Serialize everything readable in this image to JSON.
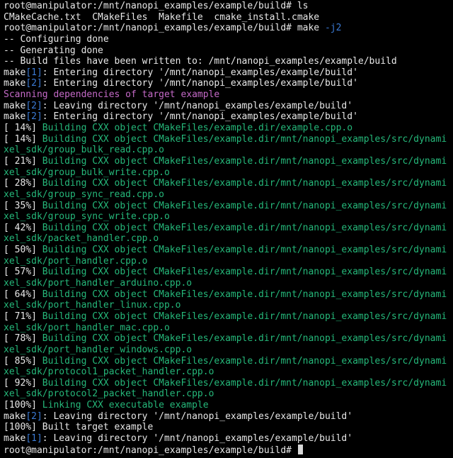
{
  "colors": {
    "background": "#000000",
    "default": "#e8e8e8",
    "green": "#25b87a",
    "blue": "#3b7bd6",
    "magenta": "#c56ac8",
    "cursor": "#d8d8d8"
  },
  "terminal": {
    "lines": [
      [
        {
          "t": "root@manipulator:/mnt/nanopi_examples/example/build# ls",
          "c": "default"
        }
      ],
      [
        {
          "t": "CMakeCache.txt  CMakeFiles  Makefile  cmake_install.cmake",
          "c": "default"
        }
      ],
      [
        {
          "t": "root@manipulator:/mnt/nanopi_examples/example/build# make ",
          "c": "default"
        },
        {
          "t": "-j2",
          "c": "blue"
        }
      ],
      [
        {
          "t": "-- Configuring done",
          "c": "default"
        }
      ],
      [
        {
          "t": "-- Generating done",
          "c": "default"
        }
      ],
      [
        {
          "t": "-- Build files have been written to: /mnt/nanopi_examples/example/build",
          "c": "default"
        }
      ],
      [
        {
          "t": "make",
          "c": "default"
        },
        {
          "t": "[1]",
          "c": "blue"
        },
        {
          "t": ": Entering directory '/mnt/nanopi_examples/example/build'",
          "c": "default"
        }
      ],
      [
        {
          "t": "make",
          "c": "default"
        },
        {
          "t": "[2]",
          "c": "blue"
        },
        {
          "t": ": Entering directory '/mnt/nanopi_examples/example/build'",
          "c": "default"
        }
      ],
      [
        {
          "t": "Scanning dependencies of target example",
          "c": "magenta"
        }
      ],
      [
        {
          "t": "make",
          "c": "default"
        },
        {
          "t": "[2]",
          "c": "blue"
        },
        {
          "t": ": Leaving directory '/mnt/nanopi_examples/example/build'",
          "c": "default"
        }
      ],
      [
        {
          "t": "make",
          "c": "default"
        },
        {
          "t": "[2]",
          "c": "blue"
        },
        {
          "t": ": Entering directory '/mnt/nanopi_examples/example/build'",
          "c": "default"
        }
      ],
      [
        {
          "t": "[ 14%] ",
          "c": "default"
        },
        {
          "t": "Building CXX object CMakeFiles/example.dir/example.cpp.o",
          "c": "green"
        }
      ],
      [
        {
          "t": "[ 14%] ",
          "c": "default"
        },
        {
          "t": "Building CXX object CMakeFiles/example.dir/mnt/nanopi_examples/src/dynami",
          "c": "green"
        }
      ],
      [
        {
          "t": "xel_sdk/group_bulk_read.cpp.o",
          "c": "green"
        }
      ],
      [
        {
          "t": "[ 21%] ",
          "c": "default"
        },
        {
          "t": "Building CXX object CMakeFiles/example.dir/mnt/nanopi_examples/src/dynami",
          "c": "green"
        }
      ],
      [
        {
          "t": "xel_sdk/group_bulk_write.cpp.o",
          "c": "green"
        }
      ],
      [
        {
          "t": "[ 28%] ",
          "c": "default"
        },
        {
          "t": "Building CXX object CMakeFiles/example.dir/mnt/nanopi_examples/src/dynami",
          "c": "green"
        }
      ],
      [
        {
          "t": "xel_sdk/group_sync_read.cpp.o",
          "c": "green"
        }
      ],
      [
        {
          "t": "[ 35%] ",
          "c": "default"
        },
        {
          "t": "Building CXX object CMakeFiles/example.dir/mnt/nanopi_examples/src/dynami",
          "c": "green"
        }
      ],
      [
        {
          "t": "xel_sdk/group_sync_write.cpp.o",
          "c": "green"
        }
      ],
      [
        {
          "t": "[ 42%] ",
          "c": "default"
        },
        {
          "t": "Building CXX object CMakeFiles/example.dir/mnt/nanopi_examples/src/dynami",
          "c": "green"
        }
      ],
      [
        {
          "t": "xel_sdk/packet_handler.cpp.o",
          "c": "green"
        }
      ],
      [
        {
          "t": "[ 50%] ",
          "c": "default"
        },
        {
          "t": "Building CXX object CMakeFiles/example.dir/mnt/nanopi_examples/src/dynami",
          "c": "green"
        }
      ],
      [
        {
          "t": "xel_sdk/port_handler.cpp.o",
          "c": "green"
        }
      ],
      [
        {
          "t": "[ 57%] ",
          "c": "default"
        },
        {
          "t": "Building CXX object CMakeFiles/example.dir/mnt/nanopi_examples/src/dynami",
          "c": "green"
        }
      ],
      [
        {
          "t": "xel_sdk/port_handler_arduino.cpp.o",
          "c": "green"
        }
      ],
      [
        {
          "t": "[ 64%] ",
          "c": "default"
        },
        {
          "t": "Building CXX object CMakeFiles/example.dir/mnt/nanopi_examples/src/dynami",
          "c": "green"
        }
      ],
      [
        {
          "t": "xel_sdk/port_handler_linux.cpp.o",
          "c": "green"
        }
      ],
      [
        {
          "t": "[ 71%] ",
          "c": "default"
        },
        {
          "t": "Building CXX object CMakeFiles/example.dir/mnt/nanopi_examples/src/dynami",
          "c": "green"
        }
      ],
      [
        {
          "t": "xel_sdk/port_handler_mac.cpp.o",
          "c": "green"
        }
      ],
      [
        {
          "t": "[ 78%] ",
          "c": "default"
        },
        {
          "t": "Building CXX object CMakeFiles/example.dir/mnt/nanopi_examples/src/dynami",
          "c": "green"
        }
      ],
      [
        {
          "t": "xel_sdk/port_handler_windows.cpp.o",
          "c": "green"
        }
      ],
      [
        {
          "t": "[ 85%] ",
          "c": "default"
        },
        {
          "t": "Building CXX object CMakeFiles/example.dir/mnt/nanopi_examples/src/dynami",
          "c": "green"
        }
      ],
      [
        {
          "t": "xel_sdk/protocol1_packet_handler.cpp.o",
          "c": "green"
        }
      ],
      [
        {
          "t": "[ 92%] ",
          "c": "default"
        },
        {
          "t": "Building CXX object CMakeFiles/example.dir/mnt/nanopi_examples/src/dynami",
          "c": "green"
        }
      ],
      [
        {
          "t": "xel_sdk/protocol2_packet_handler.cpp.o",
          "c": "green"
        }
      ],
      [
        {
          "t": "[100%] ",
          "c": "default"
        },
        {
          "t": "Linking CXX executable example",
          "c": "green"
        }
      ],
      [
        {
          "t": "make",
          "c": "default"
        },
        {
          "t": "[2]",
          "c": "blue"
        },
        {
          "t": ": Leaving directory '/mnt/nanopi_examples/example/build'",
          "c": "default"
        }
      ],
      [
        {
          "t": "[100%] Built target example",
          "c": "default"
        }
      ],
      [
        {
          "t": "make",
          "c": "default"
        },
        {
          "t": "[1]",
          "c": "blue"
        },
        {
          "t": ": Leaving directory '/mnt/nanopi_examples/example/build'",
          "c": "default"
        }
      ]
    ],
    "prompt": "root@manipulator:/mnt/nanopi_examples/example/build# "
  }
}
